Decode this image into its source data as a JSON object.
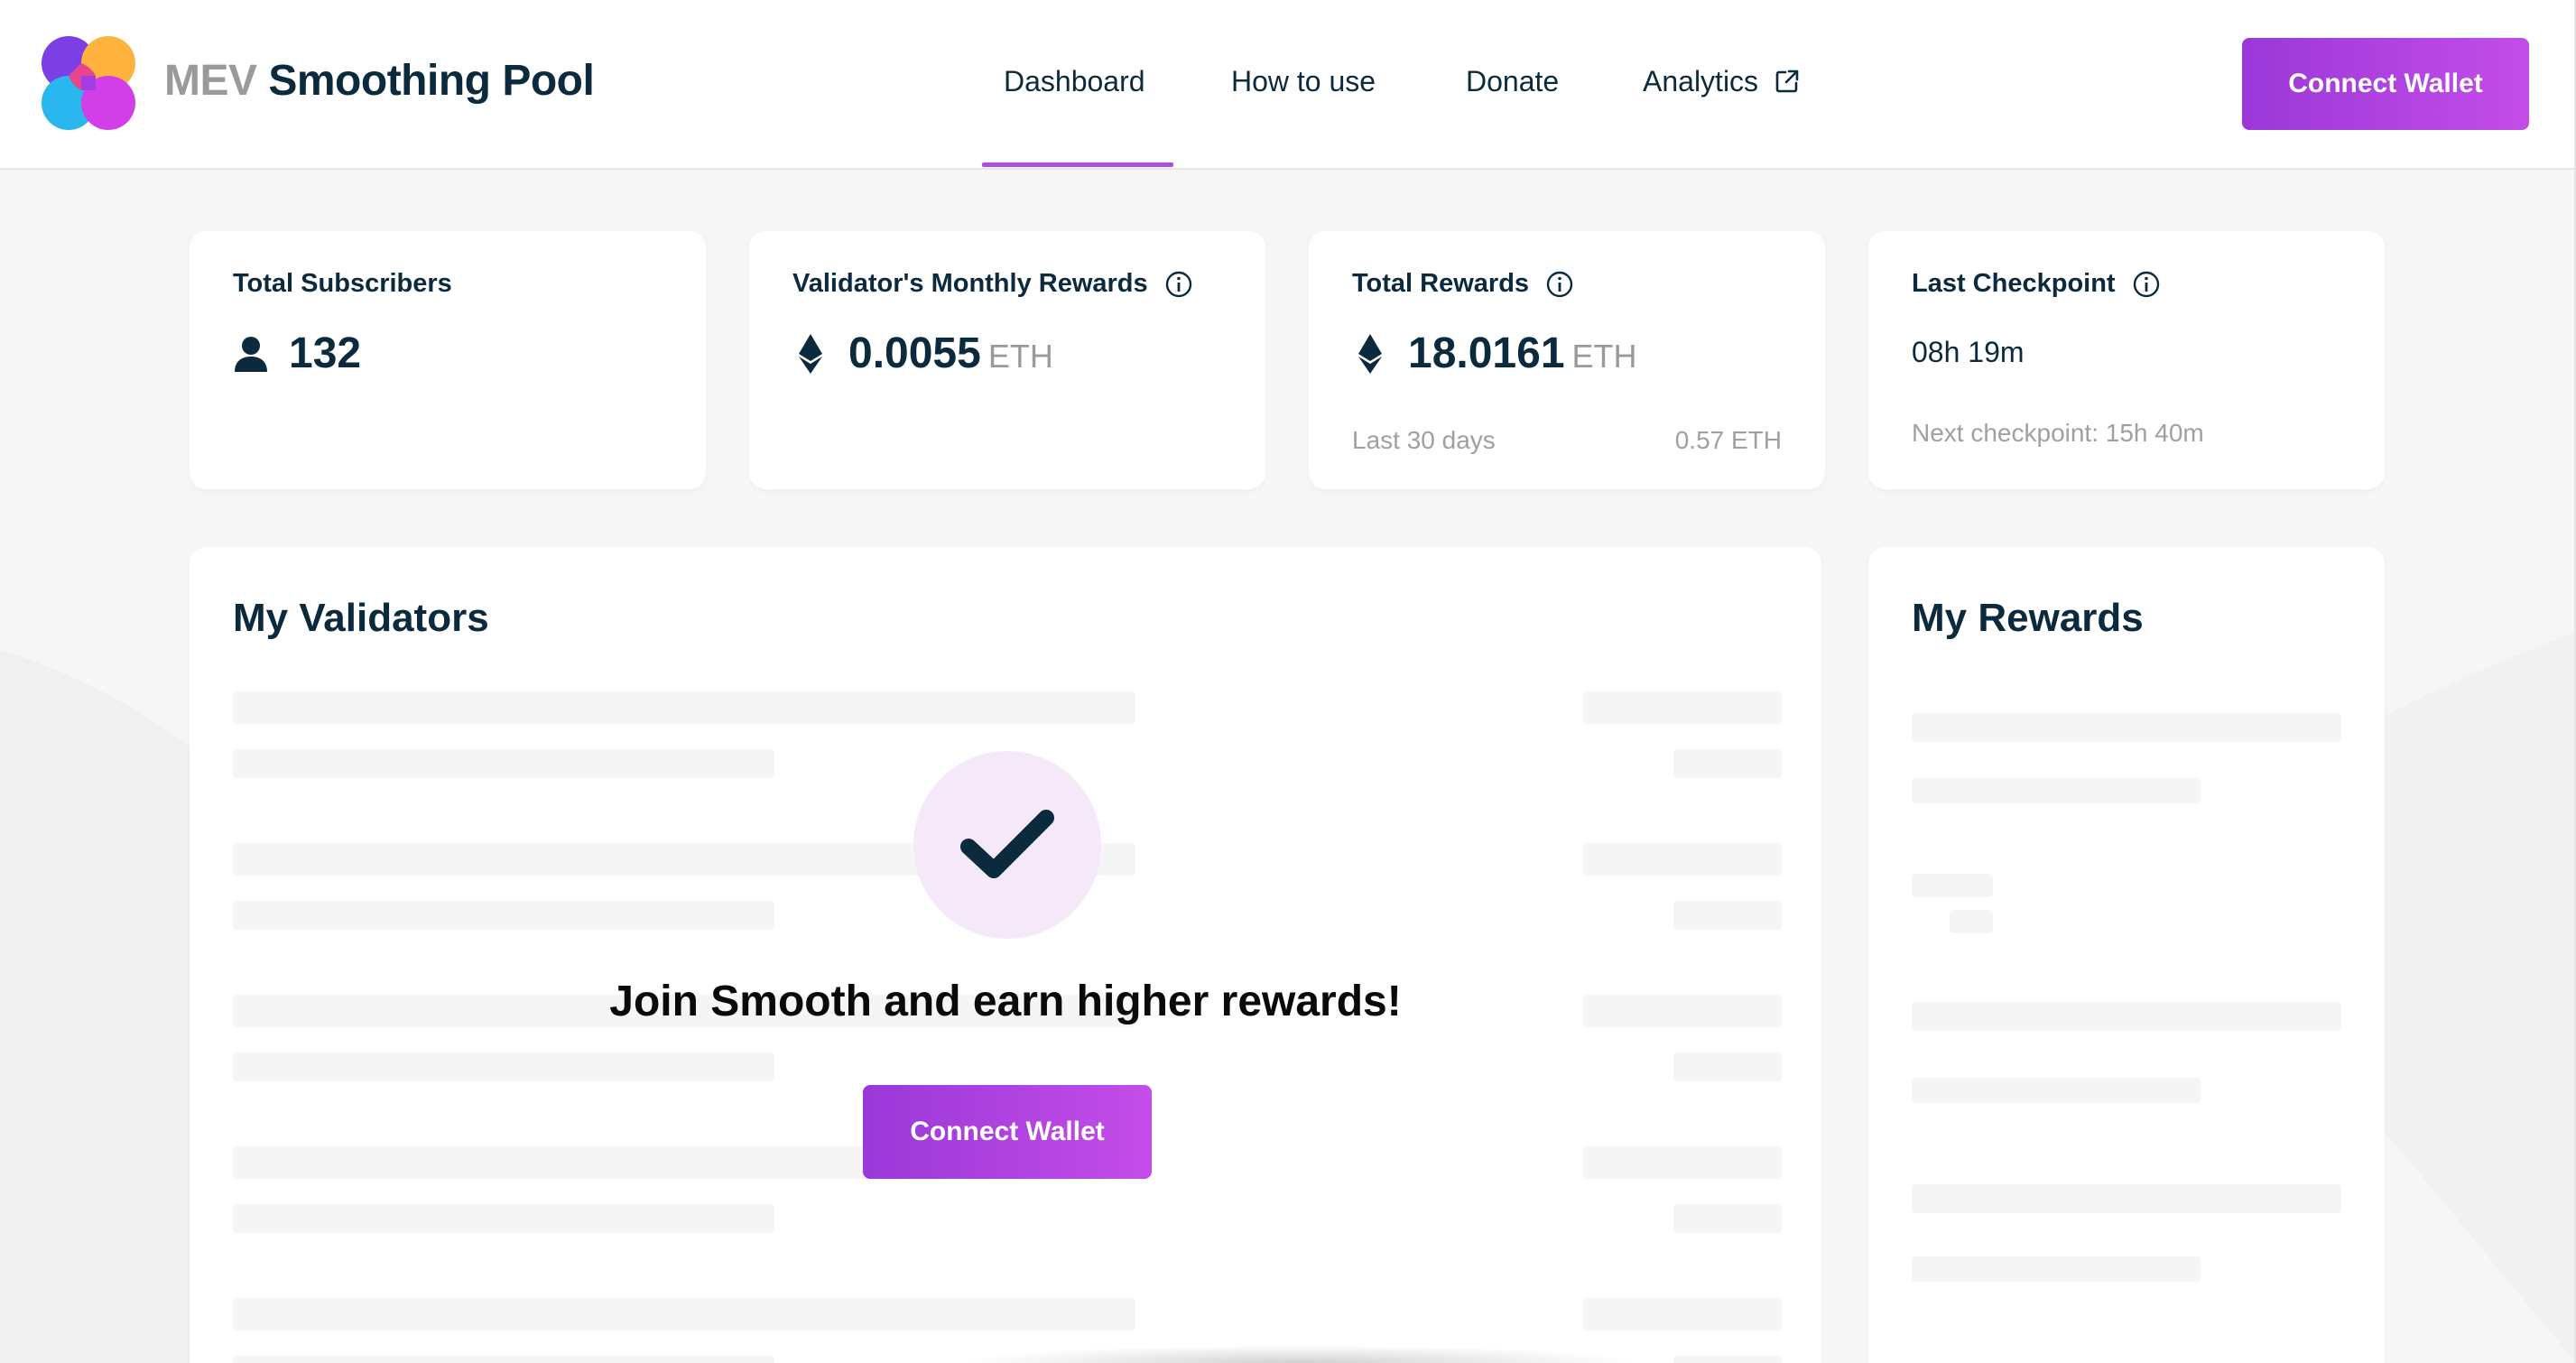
{
  "header": {
    "brand_prefix": "MEV",
    "brand_name": "Smoothing Pool",
    "nav": {
      "dashboard": "Dashboard",
      "how_to_use": "How to use",
      "donate": "Donate",
      "analytics": "Analytics"
    },
    "active_nav": "Dashboard",
    "connect_wallet": "Connect Wallet"
  },
  "stats": {
    "subscribers": {
      "label": "Total Subscribers",
      "value": "132",
      "icon": "user-icon"
    },
    "monthly_rewards": {
      "label": "Validator's Monthly Rewards",
      "value": "0.0055",
      "unit": "ETH",
      "icon": "ethereum-icon"
    },
    "total_rewards": {
      "label": "Total Rewards",
      "value": "18.0161",
      "unit": "ETH",
      "period": "Last 30 days",
      "period_value": "0.57 ETH",
      "icon": "ethereum-icon"
    },
    "last_checkpoint": {
      "label": "Last Checkpoint",
      "value": "08h 19m",
      "next": "Next checkpoint: 15h 40m"
    }
  },
  "validators": {
    "title": "My Validators",
    "cta_text": "Join Smooth and earn higher rewards!",
    "cta_button": "Connect Wallet",
    "cta_icon": "checkmark-icon"
  },
  "rewards": {
    "title": "My Rewards"
  },
  "colors": {
    "accent_start": "#9a38d8",
    "accent_end": "#c44de8",
    "text_dark": "#0b2a3d",
    "muted": "#9a9a9a",
    "background": "#f6f6f6"
  }
}
